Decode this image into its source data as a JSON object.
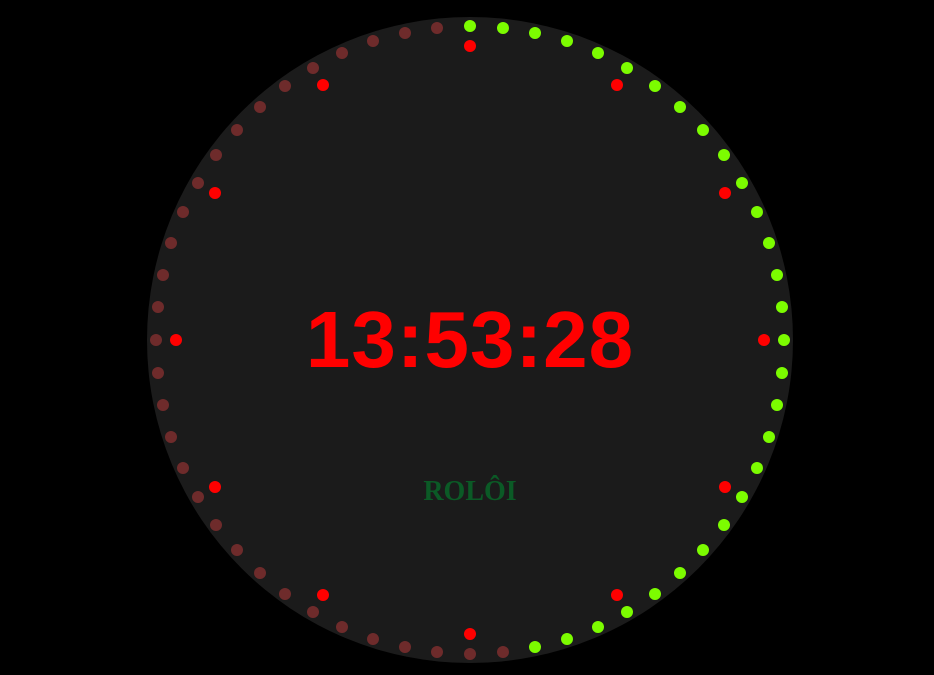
{
  "clock": {
    "time": "13:53:28",
    "brand": "ROLÔI",
    "seconds": 28,
    "hour_marker_count": 12,
    "second_dot_count": 60
  },
  "colors": {
    "background": "#000000",
    "face": "#1b1b1b",
    "time_text": "#ff0000",
    "brand_text": "#0b5a26",
    "hour_marker": "#ff0000",
    "elapsed_second_dot": "#7cfc00",
    "remaining_second_dot": "#6e2b2b"
  }
}
